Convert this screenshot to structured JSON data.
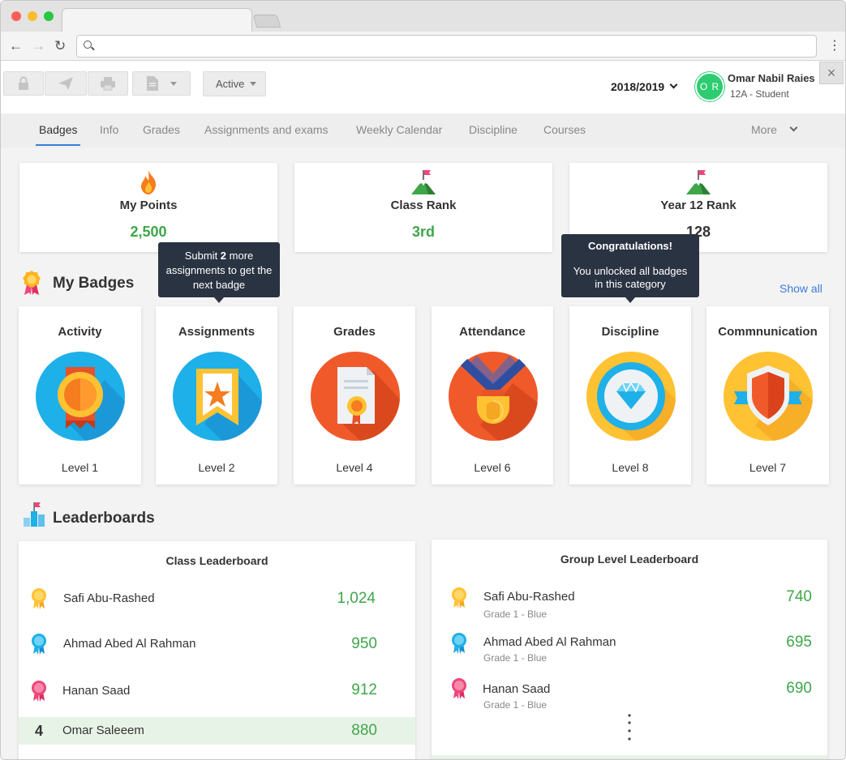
{
  "toolbar": {
    "status_label": "Active"
  },
  "header": {
    "year": "2018/2019",
    "user_initials": "O R",
    "user_name": "Omar Nabil Raies",
    "user_role": "12A - Student"
  },
  "tabs": [
    "Badges",
    "Info",
    "Grades",
    "Assignments and exams",
    "Weekly Calendar",
    "Discipline",
    "Courses"
  ],
  "tabs_more": "More",
  "stats": [
    {
      "title": "My Points",
      "value": "2,500",
      "icon": "fire-icon"
    },
    {
      "title": "Class Rank",
      "value": "3rd",
      "icon": "mountain-flag-icon"
    },
    {
      "title": "Year 12 Rank",
      "value": "128",
      "icon": "mountain-flag-icon"
    }
  ],
  "badges_section": {
    "title": "My Badges",
    "show_all": "Show all",
    "tooltip_assignments": {
      "prefix": "Submit ",
      "bold": "2",
      "suffix": " more assignments to get the next badge"
    },
    "tooltip_discipline": {
      "title": "Congratulations!",
      "body": "You unlocked all badges in this category"
    },
    "items": [
      {
        "title": "Activity",
        "level": "Level 1",
        "icon": "ribbon-medal-icon"
      },
      {
        "title": "Assignments",
        "level": "Level 2",
        "icon": "star-bookmark-icon"
      },
      {
        "title": "Grades",
        "level": "Level 4",
        "icon": "certificate-icon"
      },
      {
        "title": "Attendance",
        "level": "Level 6",
        "icon": "trophy-medal-icon"
      },
      {
        "title": "Discipline",
        "level": "Level 8",
        "icon": "diamond-icon"
      },
      {
        "title": "Commnunication",
        "level": "Level 7",
        "icon": "shield-icon"
      }
    ]
  },
  "leaderboards": {
    "title": "Leaderboards",
    "class": {
      "title": "Class Leaderboard",
      "rows": [
        {
          "name": "Safi Abu-Rashed",
          "score": "1,024",
          "medal": "gold"
        },
        {
          "name": "Ahmad Abed Al Rahman",
          "score": "950",
          "medal": "blue"
        },
        {
          "name": "Hanan Saad",
          "score": "912",
          "medal": "pink"
        }
      ],
      "me": {
        "rank": "4",
        "name": "Omar Saleeem",
        "score": "880"
      }
    },
    "group": {
      "title": "Group Level Leaderboard",
      "rows": [
        {
          "name": "Safi Abu-Rashed",
          "sub": "Grade 1 - Blue",
          "score": "740",
          "medal": "gold"
        },
        {
          "name": "Ahmad Abed Al Rahman",
          "sub": "Grade 1 - Blue",
          "score": "695",
          "medal": "blue"
        },
        {
          "name": "Hanan Saad",
          "sub": "Grade 1 - Blue",
          "score": "690",
          "medal": "pink"
        }
      ]
    }
  },
  "colors": {
    "accent": "#3b7dd8",
    "score_green": "#3fa64a",
    "avatar_green": "#2ecc71",
    "tooltip_bg": "#2a3342"
  }
}
